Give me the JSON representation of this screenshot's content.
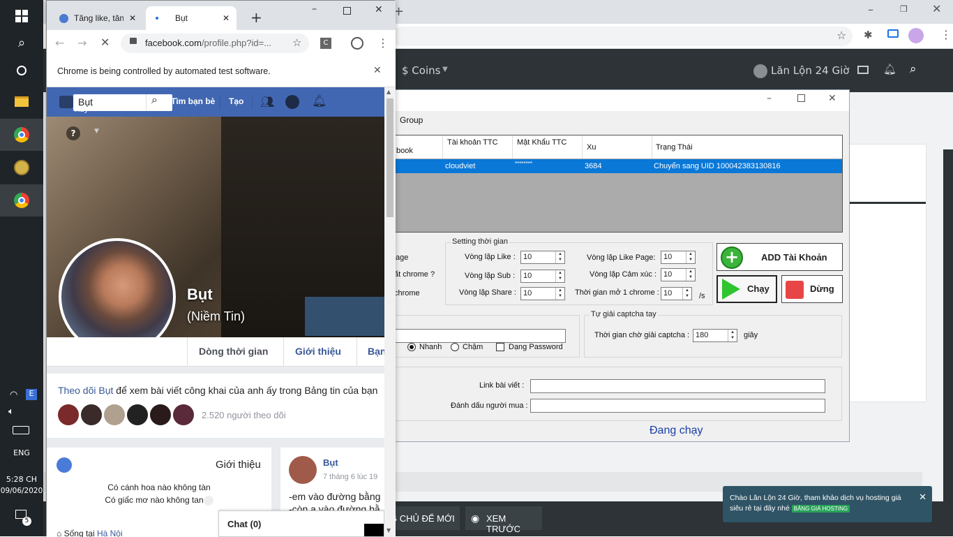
{
  "taskbar": {
    "time": "5:28 CH",
    "date": "09/06/2020",
    "lang": "ENG",
    "notif_count": "5"
  },
  "bg_site": {
    "coins_label": "$ Coins",
    "user_name": "Lăn Lộn 24 Giờ",
    "bottom_btn1": "G CHỦ ĐỂ MỚI",
    "bottom_btn2": "XEM TRƯỚC",
    "toast_text": "Chào Lăn Lộn 24 Giờ, tham khảo dịch vụ hosting giá siêu rẻ tại đây nhé",
    "toast_badge": "BẢNG GIÁ HOSTING"
  },
  "app": {
    "menu_group": "Group",
    "table": {
      "headers": [
        "book",
        "Tài khoản TTC",
        "Mật Khẩu TTC",
        "Xu",
        "Trạng Thái"
      ],
      "row": [
        "",
        "cloudviet",
        "********",
        "3684",
        "Chuyển sang UID 100042383130816"
      ]
    },
    "left_labels": [
      "age",
      "ất chrome ?",
      "chrome"
    ],
    "setting_title": "Setting thời gian",
    "vong_lap_like": "Vòng lặp Like :",
    "vong_lap_sub": "Vòng lặp Sub :",
    "vong_lap_share": "Vòng lặp Share :",
    "vong_lap_like_page": "Vòng lặp Like Page:",
    "vong_lap_cam_xuc": "Vòng lặp Cảm xúc :",
    "thoi_gian_mo": "Thời gian mở 1 chrome :",
    "unit_s": "/s",
    "v_like": "10",
    "v_sub": "10",
    "v_share": "10",
    "v_like_page": "10",
    "v_cam_xuc": "10",
    "v_mo": "10",
    "add_btn": "ADD Tài Khoản",
    "run_btn": "Chạy",
    "stop_btn": "Dừng",
    "captcha_title": "Tự giải captcha tay",
    "captcha_label": "Thời gian chờ giải captcha :",
    "captcha_value": "180",
    "captcha_unit": "giây",
    "radio_fast": "Nhanh",
    "radio_slow": "Chậm",
    "chk_password": "Dạng Password",
    "link_label": "Link bài viết :",
    "mark_label": "Đánh dấu người mua :",
    "status": "Đang chạy"
  },
  "front_chrome": {
    "tab1": "Tăng like, tăn",
    "tab2": "Bụt",
    "url_domain": "facebook.com",
    "url_path": "/profile.php?id=...",
    "info_bar": "Chrome is being controlled by automated test software."
  },
  "fb": {
    "search_value": "Bụt",
    "find_friends": "Tìm bạn bè",
    "create": "Tạo",
    "profile_name": "Bụt",
    "profile_alt": "(Niềm Tin)",
    "tab_timeline": "Dòng thời gian",
    "tab_about": "Giới thiệu",
    "tab_friends": "Bạn",
    "follow_link": "Theo dõi Bụt",
    "follow_text": " để xem bài viết công khai của anh ấy trong Bảng tin của bạn",
    "followers": "2.520 người theo dõi",
    "intro_title": "Giới thiệu",
    "intro_line1": "Có cánh hoa nào không tàn",
    "intro_line2": "Có giấc mơ nào không tan",
    "lives_in": "Sống tại ",
    "lives_city": "Hà Nội",
    "post_author": "Bụt",
    "post_time": "7 tháng 6 lúc 19",
    "post_line1": "-em vào đường bằng",
    "post_line2": "-còn a vào đường bằ",
    "chat": "Chat (0)",
    "hay": "Hay"
  }
}
